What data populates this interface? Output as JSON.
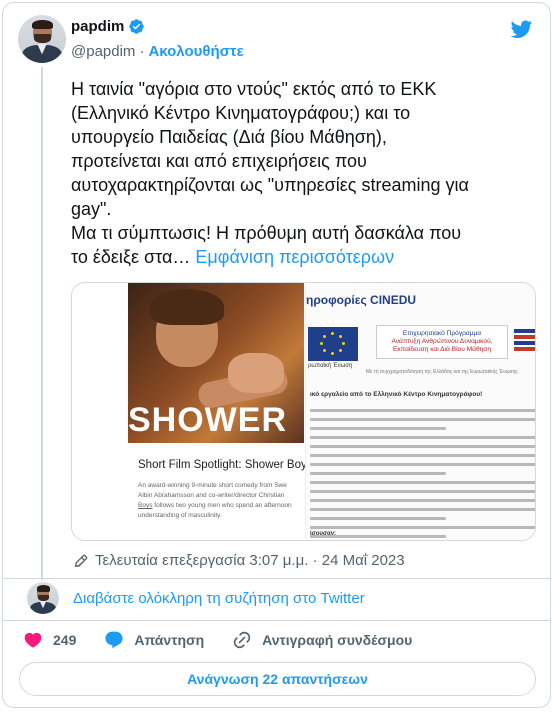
{
  "author": {
    "display_name": "papdim",
    "handle": "@papdim",
    "separator": "·",
    "follow_label": "Ακολουθήστε"
  },
  "tweet": {
    "text": "Η ταινία \"αγόρια στο ντούς\" εκτός από το ΕΚΚ\n(Ελληνικό Κέντρο Κινηματογράφου;) και το\nυπουργείο Παιδείας (Διά βίου Μάθηση),\nπροτείνεται και από επιχειρήσεις που\nαυτοχαρακτηρίζονται ως \"υπηρεσίες streaming για\ngay\".\nΜα τι σύμπτωσις! Η πρόθυμη αυτή δασκάλα που\nτο έδειξε στα…",
    "show_more": "Εμφάνιση περισσότερων"
  },
  "media": {
    "film_word": "SHOWER",
    "spotlight_title": "Short Film Spotlight: Shower Boys",
    "spotlight_body_1": "An award-winning 9-minute short comedy from Swe",
    "spotlight_body_2": "Albin Abrahamsson and co-writer/director Christian",
    "spotlight_body_3_link": "Boys",
    "spotlight_body_3": " follows two young men who spend an afternoon",
    "spotlight_body_4": "understanding of masculinity.",
    "right_title": "ηροφορίες CINEDU",
    "eu_caption": "ρωπαϊκή Ένωση",
    "program_line_1": "Επιχειρησιακό Πρόγραμμα",
    "program_line_2": "Ανάπτυξη Ανθρώπινου Δυναμικού,",
    "program_line_3": "Εκπαίδευση και Διά Βίου Μάθηση",
    "program_note": "Με τη συγχρηματοδότηση της Ελλάδας και της Ευρωπαϊκής Ένωσης",
    "right_heading": "ικό εργαλείο από το Ελληνικό Κέντρο Κινηματογράφου!",
    "right_footer": "ίσουσαν:"
  },
  "edited": {
    "label": "Τελευταία επεξεργασία 3:07 μ.μ. · 24 Μαΐ 2023"
  },
  "thread": {
    "link": "Διαβάστε ολόκληρη τη συζήτηση στο Twitter"
  },
  "actions": {
    "like_count": "249",
    "reply_label": "Απάντηση",
    "copy_label": "Αντιγραφή συνδέσμου"
  },
  "read_replies": {
    "label": "Ανάγνωση 22 απαντήσεων"
  },
  "colors": {
    "accent": "#1d9bf0",
    "like": "#f91880",
    "muted": "#536471",
    "border": "#cfd9de"
  }
}
